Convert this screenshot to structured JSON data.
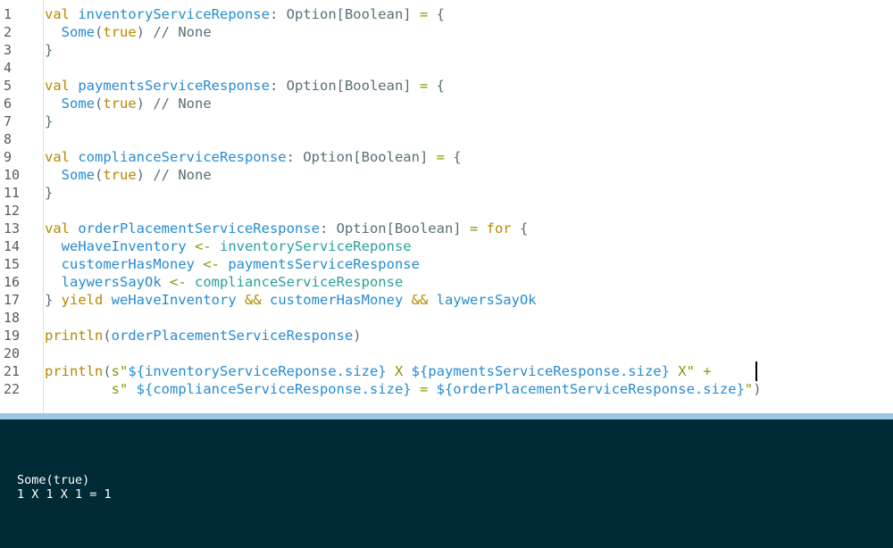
{
  "editor": {
    "line_numbers": [
      "1",
      "2",
      "3",
      "4",
      "5",
      "6",
      "7",
      "8",
      "9",
      "10",
      "11",
      "12",
      "13",
      "14",
      "15",
      "16",
      "17",
      "18",
      "19",
      "20",
      "21",
      "22"
    ],
    "lines": {
      "l1": {
        "kw": "val",
        "id": "inventoryServiceReponse",
        "colon": ": ",
        "type": "Option[Boolean]",
        "eq": " = ",
        "brace": "{"
      },
      "l2": {
        "some": "Some",
        "paren_open": "(",
        "lit": "true",
        "paren_close": ")",
        "comment": " // None"
      },
      "l3": {
        "brace": "}"
      },
      "l5": {
        "kw": "val",
        "id": "paymentsServiceResponse",
        "colon": ": ",
        "type": "Option[Boolean]",
        "eq": " = ",
        "brace": "{"
      },
      "l6": {
        "some": "Some",
        "paren_open": "(",
        "lit": "true",
        "paren_close": ")",
        "comment": " // None"
      },
      "l7": {
        "brace": "}"
      },
      "l9": {
        "kw": "val",
        "id": "complianceServiceResponse",
        "colon": ": ",
        "type": "Option[Boolean]",
        "eq": " = ",
        "brace": "{"
      },
      "l10": {
        "some": "Some",
        "paren_open": "(",
        "lit": "true",
        "paren_close": ")",
        "comment": " // None"
      },
      "l11": {
        "brace": "}"
      },
      "l13": {
        "kw": "val",
        "id": "orderPlacementServiceResponse",
        "colon": ": ",
        "type": "Option[Boolean]",
        "eq": " = ",
        "for": "for",
        "brace": " {"
      },
      "l14": {
        "lhs": "weHaveInventory",
        "arrow": " <- ",
        "rhs": "inventoryServiceReponse"
      },
      "l15": {
        "lhs": "customerHasMoney",
        "arrow": " <- ",
        "rhs": "paymentsServiceResponse"
      },
      "l16": {
        "lhs": "laywersSayOk",
        "arrow": " <- ",
        "rhs": "complianceServiceResponse"
      },
      "l17": {
        "brace": "} ",
        "yield": "yield",
        "a": " weHaveInventory",
        "and1": " && ",
        "b": "customerHasMoney",
        "and2": " && ",
        "c": "laywersSayOk"
      },
      "l19": {
        "fn": "println",
        "open": "(",
        "arg": "orderPlacementServiceResponse",
        "close": ")"
      },
      "l21": {
        "fn": "println",
        "open": "(",
        "s": "s",
        "q1": "\"",
        "i1": "${inventoryServiceReponse.size}",
        "x1": " X ",
        "i2": "${paymentsServiceResponse.size}",
        "x2": " X\"",
        "plus": " +"
      },
      "l22": {
        "indent": "        ",
        "s": "s",
        "q1": "\" ",
        "i3": "${complianceServiceResponse.size}",
        "eq": " = ",
        "i4": "${orderPlacementServiceResponse.size}",
        "q2": "\"",
        "close": ")"
      }
    }
  },
  "console": {
    "output_lines": [
      "Some(true)",
      "1 X 1 X 1 = 1"
    ]
  },
  "colors": {
    "keyword": "#b58900",
    "identifier": "#268bd2",
    "string": "#859900",
    "console_bg": "#002b36",
    "divider": "#9bc7e3"
  }
}
